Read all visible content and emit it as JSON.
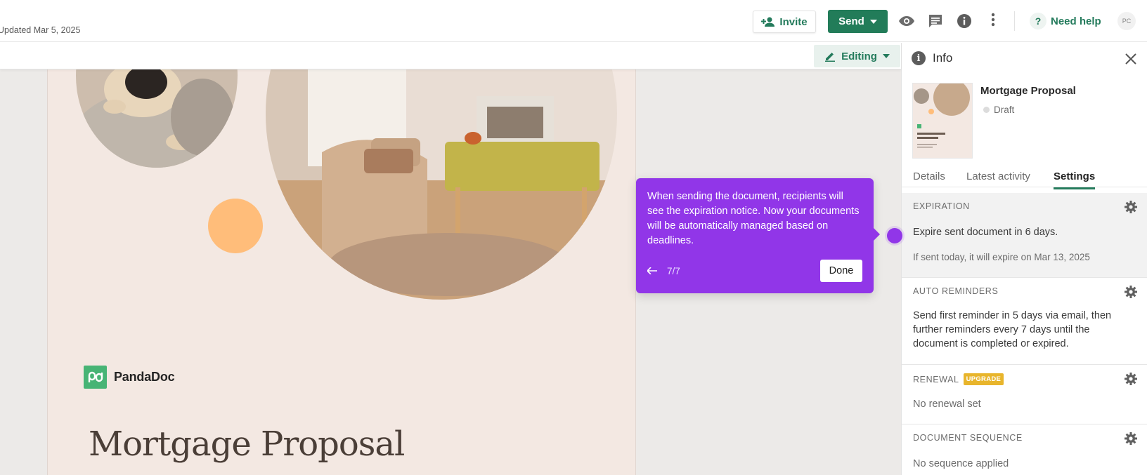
{
  "header": {
    "updated": "Updated Mar 5, 2025",
    "invite_label": "Invite",
    "send_label": "Send",
    "need_help_label": "Need help",
    "avatar_initials": "PC"
  },
  "toolbar": {
    "mode_label": "Editing"
  },
  "document": {
    "brand_name": "PandaDoc",
    "title": "Mortgage Proposal"
  },
  "tooltip": {
    "text": "When sending the document, recipients will see the expiration notice. Now your documents will be automatically managed based on deadlines.",
    "step": "7/7",
    "done_label": "Done"
  },
  "panel": {
    "title": "Info",
    "doc_name": "Mortgage Proposal",
    "status": "Draft",
    "tabs": [
      {
        "label": "Details"
      },
      {
        "label": "Latest activity"
      },
      {
        "label": "Settings"
      }
    ],
    "active_tab": "Settings",
    "sections": {
      "expiration": {
        "heading": "EXPIRATION",
        "text": "Expire sent document in 6 days.",
        "sub": "If sent today, it will expire on Mar 13, 2025"
      },
      "reminders": {
        "heading": "AUTO REMINDERS",
        "text": "Send first reminder in 5 days via email, then further reminders every 7 days until the document is completed or expired."
      },
      "renewal": {
        "heading": "RENEWAL",
        "badge": "UPGRADE",
        "text": "No renewal set"
      },
      "sequence": {
        "heading": "DOCUMENT SEQUENCE",
        "text": "No sequence applied"
      }
    }
  },
  "colors": {
    "brand_green": "#227c59",
    "tooltip_purple": "#9136e8",
    "upgrade_badge": "#e8b52c"
  }
}
